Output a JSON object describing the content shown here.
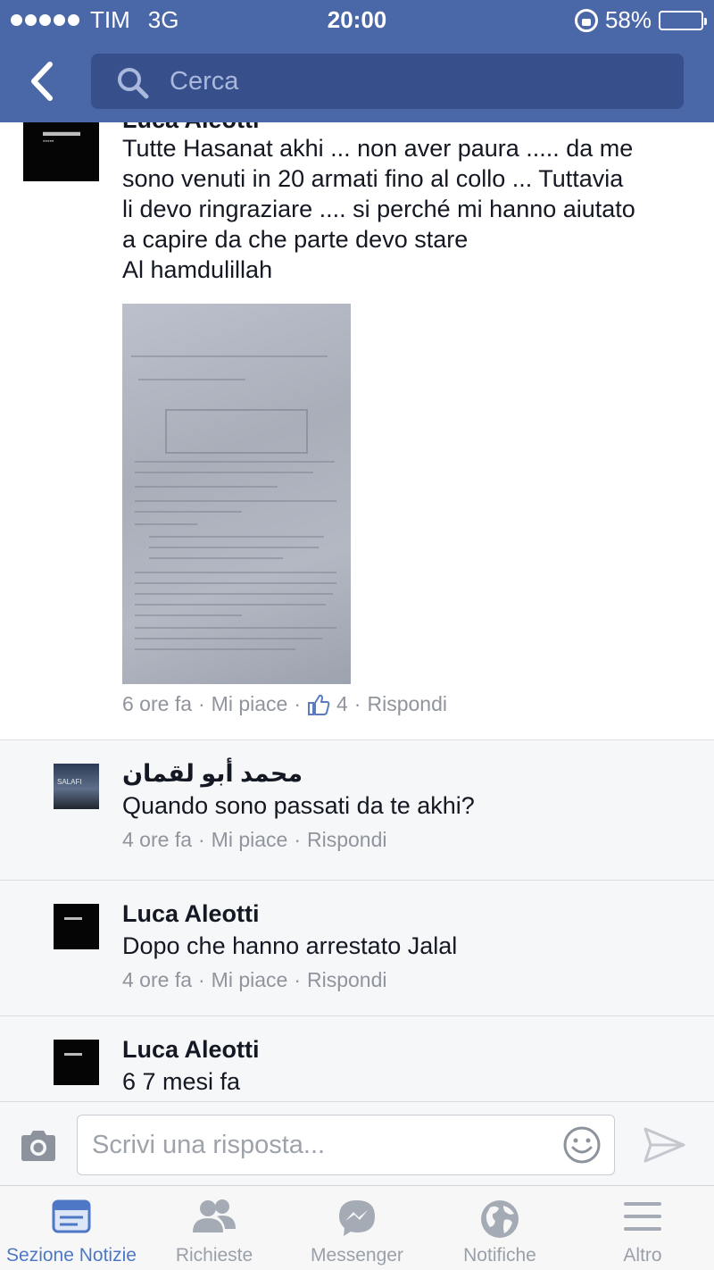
{
  "status_bar": {
    "carrier": "TIM",
    "network": "3G",
    "time": "20:00",
    "battery": "58%",
    "battery_level": 0.58
  },
  "header": {
    "search_placeholder": "Cerca"
  },
  "post_comment": {
    "author": "Luca Aleotti",
    "text_lines": [
      "Tutte Hasanat akhi ... non aver paura ..... da me",
      "sono venuti in 20 armati fino al collo ... Tuttavia",
      "li devo ringraziare .... si perché mi hanno aiutato",
      "a capire da che parte devo stare",
      "Al hamdulillah"
    ],
    "time": "6 ore fa",
    "like": "Mi piace",
    "like_count": "4",
    "reply": "Rispondi",
    "separator": "·"
  },
  "replies": [
    {
      "author": "محمد أبو لقمان",
      "text": "Quando sono passati da te akhi?",
      "time": "4 ore fa",
      "like": "Mi piace",
      "reply": "Rispondi"
    },
    {
      "author": "Luca Aleotti",
      "text": "Dopo che hanno arrestato Jalal",
      "time": "4 ore fa",
      "like": "Mi piace",
      "reply": "Rispondi"
    },
    {
      "author": "Luca Aleotti",
      "text": "6 7 mesi fa"
    }
  ],
  "composer": {
    "placeholder": "Scrivi una risposta..."
  },
  "tabs": [
    {
      "label": "Sezione Notizie",
      "icon": "news-feed-icon",
      "active": true
    },
    {
      "label": "Richieste",
      "icon": "friend-requests-icon",
      "active": false
    },
    {
      "label": "Messenger",
      "icon": "messenger-icon",
      "active": false
    },
    {
      "label": "Notifiche",
      "icon": "globe-icon",
      "active": false
    },
    {
      "label": "Altro",
      "icon": "menu-icon",
      "active": false
    }
  ],
  "colors": {
    "header_blue": "#4a67a8",
    "search_field": "#37508c",
    "active_tab": "#4e78c6",
    "meta_gray": "#90949c"
  }
}
